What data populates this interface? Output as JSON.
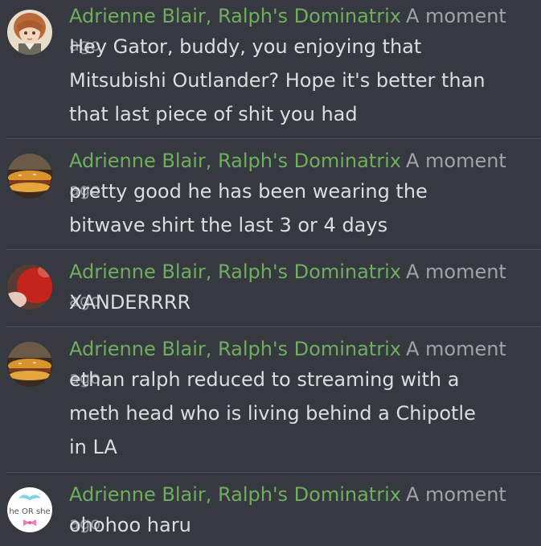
{
  "messages": [
    {
      "author": "Adrienne Blair, Ralph's Dominatrix",
      "time": "A moment",
      "time_overflow": "ago",
      "avatar": "anime-girl-avatar",
      "lines": [
        "Hey Gator, buddy, you enjoying that",
        "Mitsubishi Outlander? Hope it's better than",
        "that last piece of shit you had"
      ]
    },
    {
      "author": "Adrienne Blair, Ralph's Dominatrix",
      "time": "A moment",
      "time_overflow": "ago",
      "avatar": "burger-avatar",
      "lines": [
        "pretty good he has been wearing the",
        "bitwave shirt the last 3 or 4 days"
      ]
    },
    {
      "author": "Adrienne Blair, Ralph's Dominatrix",
      "time": "A moment",
      "time_overflow": "ago",
      "avatar": "red-blur-avatar",
      "lines": [
        "XANDERRRR"
      ]
    },
    {
      "author": "Adrienne Blair, Ralph's Dominatrix",
      "time": "A moment",
      "time_overflow": "ago",
      "avatar": "burger-avatar",
      "lines": [
        "ethan ralph reduced to streaming with a",
        "meth head who is living behind a Chipotle",
        "in LA"
      ]
    },
    {
      "author": "Adrienne Blair, Ralph's Dominatrix",
      "time": "A moment",
      "time_overflow": "ago",
      "avatar": "he-or-she-avatar",
      "avatar_text": "he OR she",
      "lines": [
        "ohohoo haru"
      ]
    }
  ],
  "colors": {
    "background": "#36393f",
    "author": "#6fae5f",
    "timestamp": "#a0a3a8",
    "text": "#dcddde",
    "divider": "#4a4d53"
  }
}
